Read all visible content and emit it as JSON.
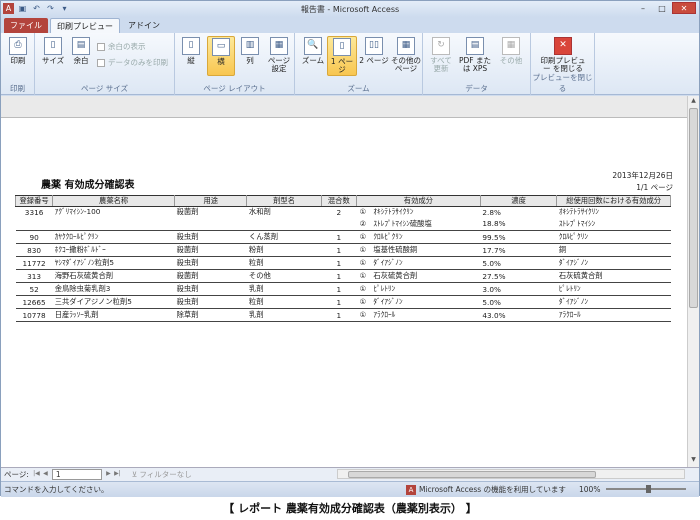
{
  "window": {
    "title": "報告書 - Microsoft Access"
  },
  "tabs": [
    "ファイル",
    "印刷プレビュー",
    "アドイン"
  ],
  "ribbon": {
    "print_group": {
      "label": "印刷",
      "print": "印刷"
    },
    "page_size_group": {
      "label": "ページ サイズ",
      "size": "サイズ",
      "margins": "余白",
      "show_margins": "余白の表示",
      "data_only": "データのみを印刷"
    },
    "layout_group": {
      "label": "ページ レイアウト",
      "portrait": "縦",
      "landscape": "横",
      "columns": "列",
      "page_setup": "ページ 設定"
    },
    "zoom_group": {
      "label": "ズーム",
      "zoom": "ズーム",
      "one_page": "1 ページ",
      "two_pages": "2 ページ",
      "more_pages": "その他の ページ"
    },
    "data_group": {
      "label": "データ",
      "refresh": "すべて 更新",
      "pdf": "PDF または XPS",
      "other": "その他"
    },
    "close_group": {
      "label": "プレビューを閉じる",
      "close": "印刷プレビュー を閉じる"
    }
  },
  "report": {
    "title": "農薬 有効成分確認表",
    "date": "2013年12月26日",
    "page": "1/1 ページ",
    "columns": [
      "登録番号",
      "農薬名称",
      "用途",
      "剤型名",
      "混合数",
      "有効成分",
      "濃度",
      "総使用回数における有効成分"
    ],
    "rows": [
      {
        "no": "3316",
        "name": "ｱｸﾞﾘﾏｲｼﾝ-100",
        "use": "殺菌剤",
        "form": "水和剤",
        "mix": "2",
        "subs": [
          {
            "n": "①",
            "ing": "ｵｷｼﾃﾄﾗｻｲｸﾘﾝ",
            "conc": "2.8%",
            "total": "ｵｷｼﾃﾄﾗｻｲｸﾘﾝ"
          },
          {
            "n": "②",
            "ing": "ｽﾄﾚﾌﾟﾄﾏｲｼﾝ硫酸塩",
            "conc": "18.8%",
            "total": "ｽﾄﾚﾌﾟﾄﾏｲｼﾝ"
          }
        ]
      },
      {
        "no": "90",
        "name": "ｶﾔｸｸﾛｰﾙﾋﾟｸﾘﾝ",
        "use": "殺虫剤",
        "form": "くん蒸剤",
        "mix": "1",
        "subs": [
          {
            "n": "①",
            "ing": "ｸﾛﾙﾋﾟｸﾘﾝ",
            "conc": "99.5%",
            "total": "ｸﾛﾙﾋﾟｸﾘﾝ"
          }
        ]
      },
      {
        "no": "830",
        "name": "ﾎｸｺｰ撒粉ﾎﾞﾙﾄﾞｰ",
        "use": "殺菌剤",
        "form": "粉剤",
        "mix": "1",
        "subs": [
          {
            "n": "①",
            "ing": "塩基性硫酸銅",
            "conc": "17.7%",
            "total": "銅"
          }
        ]
      },
      {
        "no": "11772",
        "name": "ﾔｼﾏﾀﾞｲｱｼﾞﾉﾝ粒剤5",
        "use": "殺虫剤",
        "form": "粒剤",
        "mix": "1",
        "subs": [
          {
            "n": "①",
            "ing": "ﾀﾞｲｱｼﾞﾉﾝ",
            "conc": "5.0%",
            "total": "ﾀﾞｲｱｼﾞﾉﾝ"
          }
        ]
      },
      {
        "no": "313",
        "name": "海野石灰硫黄合剤",
        "use": "殺菌剤",
        "form": "その他",
        "mix": "1",
        "subs": [
          {
            "n": "①",
            "ing": "石灰硫黄合剤",
            "conc": "27.5%",
            "total": "石灰硫黄合剤"
          }
        ]
      },
      {
        "no": "52",
        "name": "金鳥除虫菊乳剤3",
        "use": "殺虫剤",
        "form": "乳剤",
        "mix": "1",
        "subs": [
          {
            "n": "①",
            "ing": "ﾋﾟﾚﾄﾘﾝ",
            "conc": "3.0%",
            "total": "ﾋﾟﾚﾄﾘﾝ"
          }
        ]
      },
      {
        "no": "12665",
        "name": "三共ダイアジノン粒剤5",
        "use": "殺虫剤",
        "form": "粒剤",
        "mix": "1",
        "subs": [
          {
            "n": "①",
            "ing": "ﾀﾞｲｱｼﾞﾉﾝ",
            "conc": "5.0%",
            "total": "ﾀﾞｲｱｼﾞﾉﾝ"
          }
        ]
      },
      {
        "no": "10778",
        "name": "日産ﾗｯｿｰ乳剤",
        "use": "除草剤",
        "form": "乳剤",
        "mix": "1",
        "subs": [
          {
            "n": "①",
            "ing": "ｱﾗｸﾛｰﾙ",
            "conc": "43.0%",
            "total": "ｱﾗｸﾛｰﾙ"
          }
        ]
      }
    ]
  },
  "nav": {
    "page_label": "ページ:",
    "page_value": "1",
    "filter": "フィルターなし"
  },
  "status": {
    "command": "コマンドを入力してください。",
    "access": "Microsoft Access の機能を利用しています",
    "zoom": "100%"
  },
  "caption": "【 レポート 農薬有効成分確認表（農薬別表示） 】"
}
